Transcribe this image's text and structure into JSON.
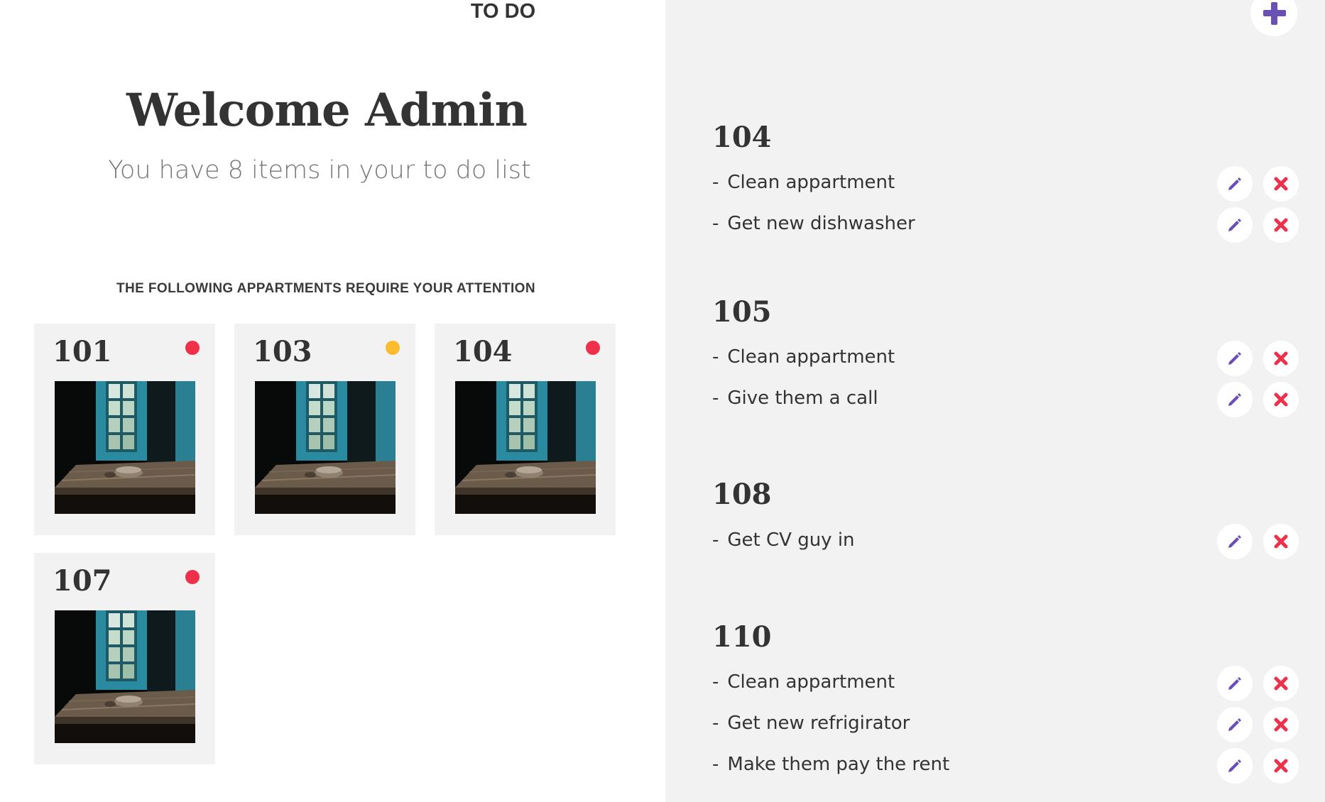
{
  "welcome": {
    "title": "Welcome Admin",
    "subtitle": "You have 8 items in your to do list"
  },
  "attention": {
    "heading": "THE FOLLOWING APPARTMENTS REQUIRE YOUR ATTENTION",
    "cards": [
      {
        "number": "101",
        "status_color": "#f0304a"
      },
      {
        "number": "103",
        "status_color": "#fbbd2e"
      },
      {
        "number": "104",
        "status_color": "#f0304a"
      },
      {
        "number": "107",
        "status_color": "#f0304a"
      }
    ]
  },
  "todo": {
    "title": "TO DO",
    "add_icon": "plus-icon",
    "groups": [
      {
        "apartment": "104",
        "items": [
          "Clean appartment",
          "Get new dishwasher"
        ]
      },
      {
        "apartment": "105",
        "items": [
          "Clean appartment",
          "Give them a call"
        ]
      },
      {
        "apartment": "108",
        "items": [
          "Get CV guy in"
        ]
      },
      {
        "apartment": "110",
        "items": [
          "Clean appartment",
          "Get new refrigirator",
          "Make them pay the rent"
        ]
      }
    ],
    "item_prefix": "-",
    "edit_icon": "pencil-icon",
    "delete_icon": "close-icon"
  },
  "colors": {
    "accent": "#6a4fb5",
    "danger": "#f0304a",
    "warning": "#fbbd2e",
    "panel": "#f2f2f2"
  }
}
